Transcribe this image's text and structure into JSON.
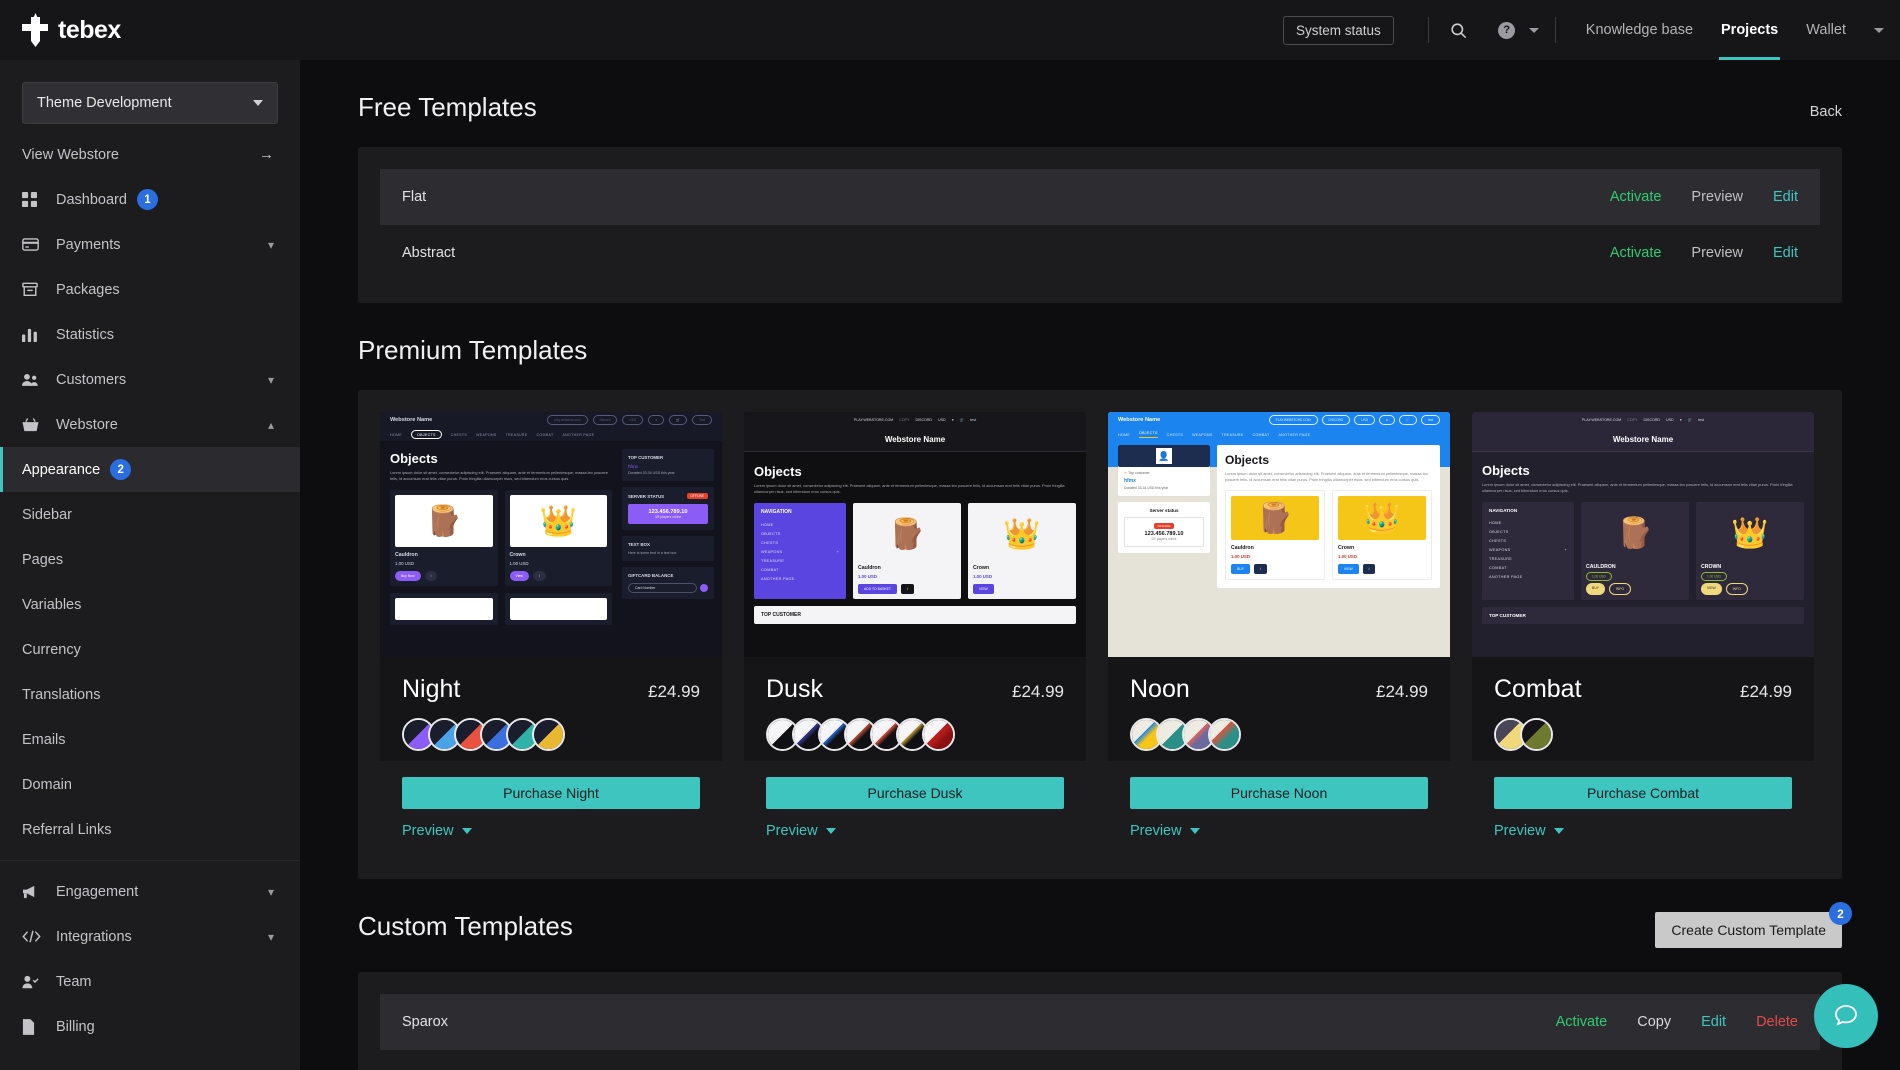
{
  "topbar": {
    "logo_text": "tebex",
    "system_status": "System status",
    "search_icon": "search-icon",
    "help_icon": "help-circle-icon",
    "links": [
      {
        "label": "Knowledge base",
        "active": false
      },
      {
        "label": "Projects",
        "active": true
      },
      {
        "label": "Wallet",
        "active": false
      }
    ]
  },
  "sidebar": {
    "project": "Theme Development",
    "view_webstore": "View Webstore",
    "items": [
      {
        "label": "Dashboard",
        "icon": "grid-icon",
        "badge": "1"
      },
      {
        "label": "Payments",
        "icon": "card-icon",
        "chevron": "down"
      },
      {
        "label": "Packages",
        "icon": "box-icon"
      },
      {
        "label": "Statistics",
        "icon": "bar-chart-icon"
      },
      {
        "label": "Customers",
        "icon": "users-icon",
        "chevron": "down"
      },
      {
        "label": "Webstore",
        "icon": "basket-icon",
        "chevron": "up"
      }
    ],
    "sub_items": [
      {
        "label": "Appearance",
        "badge": "2",
        "active": true
      },
      {
        "label": "Sidebar"
      },
      {
        "label": "Pages"
      },
      {
        "label": "Variables"
      },
      {
        "label": "Currency"
      },
      {
        "label": "Translations"
      },
      {
        "label": "Emails"
      },
      {
        "label": "Domain"
      },
      {
        "label": "Referral Links"
      }
    ],
    "bottom_items": [
      {
        "label": "Engagement",
        "icon": "megaphone-icon",
        "chevron": "down"
      },
      {
        "label": "Integrations",
        "icon": "code-icon",
        "chevron": "down"
      },
      {
        "label": "Team",
        "icon": "user-check-icon"
      },
      {
        "label": "Billing",
        "icon": "file-icon"
      }
    ]
  },
  "free_templates": {
    "title": "Free Templates",
    "back_label": "Back",
    "rows": [
      {
        "name": "Flat",
        "highlighted": true,
        "actions": [
          "Activate",
          "Preview",
          "Edit"
        ]
      },
      {
        "name": "Abstract",
        "highlighted": false,
        "actions": [
          "Activate",
          "Preview",
          "Edit"
        ]
      }
    ]
  },
  "premium_templates": {
    "title": "Premium Templates",
    "cards": [
      {
        "name": "Night",
        "price": "£24.99",
        "buy_label": "Purchase Night",
        "preview_label": "Preview",
        "swatches": [
          "#8b5cf6",
          "#4aa3e8",
          "#e8523f",
          "#3b6fe0",
          "#2fb3a8",
          "#e8b830"
        ],
        "thumb": {
          "style": "night",
          "webstore_name": "Webstore Name",
          "domain": "play.webstore.com",
          "copy": "COPY",
          "discord": "Discord",
          "currency": "USD",
          "user": "Test",
          "nav": [
            "HOME",
            "OBJECTS",
            "CHESTS",
            "WEAPONS",
            "TREASURE",
            "COMBAT",
            "ANOTHER PAGE"
          ],
          "heading": "Objects",
          "body": "Lorem ipsum dolor sit amet, consectetur adipiscing elit. Praesent aliquam, ante et fermentum pellentesque, massa leo posuere felis, id accumsan erat felis vitae purus. Proin fringilla ullamcorper risus, sed bibendum eros cursus quis.",
          "products": [
            {
              "name": "Cauldron",
              "price": "1.00 USD",
              "button": "Buy Now"
            },
            {
              "name": "Crown",
              "price": "1.00 USD",
              "button": "View"
            }
          ],
          "widgets": [
            {
              "title": "TOP CUSTOMER",
              "value": "hfmx",
              "note": "Donated 33.34 USD this year"
            },
            {
              "title": "SERVER STATUS",
              "badge": "OFFLINE",
              "ip": "123.456.789.10",
              "players": "3/5 players online"
            },
            {
              "title": "TEXT BOX",
              "note": "Here is some text in a text box."
            },
            {
              "title": "GIFTCARD BALANCE",
              "note": "Card Number"
            }
          ]
        }
      },
      {
        "name": "Dusk",
        "price": "£24.99",
        "buy_label": "Purchase Dusk",
        "preview_label": "Preview",
        "swatches": [
          "#3b3ea8",
          "#2a6ee0",
          "#c8553a",
          "#e8503a",
          "#c8a23a",
          "#c42020",
          "#8b1010"
        ],
        "thumb": {
          "style": "dusk",
          "webstore_name": "Webstore Name",
          "domain": "PLAY.WEBSTORE.COM",
          "copy": "COPY",
          "discord": "DISCORD",
          "currency": "USD",
          "user": "test",
          "heading": "Objects",
          "body": "Lorem ipsum dolor sit amet, consectetur adipiscing elit. Praesent aliquam, ante et fermentum pellentesque, massa leo posuere felis, id accumsan erat felis vitae purus. Proin fringilla ullamcorper risus, sed bibendum eros cursus quis.",
          "nav_title": "NAVIGATION",
          "nav": [
            "HOME",
            "OBJECTS",
            "CHESTS",
            "WEAPONS",
            "TREASURE",
            "COMBAT",
            "ANOTHER PAGE"
          ],
          "products": [
            {
              "name": "Cauldron",
              "price": "1.00 USD",
              "button": "ADD TO BASKET"
            },
            {
              "name": "Crown",
              "price": "1.00 USD",
              "button": "VIEW"
            }
          ],
          "widgets": [
            {
              "title": "TOP CUSTOMER"
            }
          ]
        }
      },
      {
        "name": "Noon",
        "price": "£24.99",
        "buy_label": "Purchase Noon",
        "preview_label": "Preview",
        "swatches": [
          "#f5c518",
          "#2a8f87",
          "#6b6a9c",
          "#e8503a"
        ],
        "thumb": {
          "style": "noon",
          "webstore_name": "Webstore Name",
          "domain": "PLAY.WEBSTORE.COM",
          "copy": "COPY",
          "discord": "DISCORD",
          "currency": "USD",
          "user": "test",
          "nav": [
            "HOME",
            "OBJECTS",
            "CHESTS",
            "WEAPONS",
            "TREASURE",
            "COMBAT",
            "ANOTHER PAGE"
          ],
          "heading": "Objects",
          "body": "Lorem ipsum dolor sit amet, consectetur adipiscing elit. Praesent aliquam, ante et fermentum pellentesque, massa leo posuere felis, id accumsan erat felis vitae purus. Proin fringilla ullamcorper risus, sed bibendum eros cursus quis.",
          "products": [
            {
              "name": "Cauldron",
              "price": "1.00 USD",
              "button": "BUY"
            },
            {
              "name": "Crown",
              "price": "1.00 USD",
              "button": "VIEW"
            }
          ],
          "widgets": [
            {
              "title": "Top customer",
              "value": "hfmx",
              "note": "Donated 33.34 USD this year"
            },
            {
              "title": "Server status",
              "badge": "OFFLINE",
              "ip": "123.456.789.10",
              "players": "0/0 players online"
            }
          ]
        }
      },
      {
        "name": "Combat",
        "price": "£24.99",
        "buy_label": "Purchase Combat",
        "preview_label": "Preview",
        "swatches": [
          "#f0d97a",
          "#6d7a2e"
        ],
        "thumb": {
          "style": "combat",
          "webstore_name": "Webstore Name",
          "domain": "PLAY.WEBSTORE.COM",
          "copy": "COPY",
          "discord": "DISCORD",
          "currency": "USD",
          "user": "test",
          "heading": "Objects",
          "body": "Lorem ipsum dolor sit amet, consectetur adipiscing elit. Praesent aliquam, ante et fermentum pellentesque, massa leo posuere felis, id accumsan erat felis vitae purus. Proin fringilla ullamcorper risus, sed bibendum eros cursus quis.",
          "nav_title": "NAVIGATION",
          "nav": [
            "HOME",
            "OBJECTS",
            "CHESTS",
            "WEAPONS",
            "TREASURE",
            "COMBAT",
            "ANOTHER PAGE"
          ],
          "products": [
            {
              "name": "CAULDRON",
              "price": "1.00 USD",
              "button": "BUY",
              "button2": "INFO"
            },
            {
              "name": "CROWN",
              "price": "1.00 USD",
              "button": "VIEW",
              "button2": "INFO"
            }
          ],
          "widgets": [
            {
              "title": "TOP CUSTOMER"
            }
          ]
        }
      }
    ]
  },
  "custom_templates": {
    "title": "Custom Templates",
    "create_label": "Create Custom Template",
    "create_badge": "2",
    "rows": [
      {
        "name": "Sparox",
        "highlighted": true,
        "actions": [
          "Activate",
          "Copy",
          "Edit",
          "Delete"
        ]
      }
    ]
  },
  "chat": {
    "icon": "chat-bubble-icon"
  },
  "colors": {
    "accent_teal": "#3fc5c0",
    "badge_blue": "#2a6ee0",
    "activate_green": "#2ecc71",
    "delete_red": "#e04b4b"
  }
}
